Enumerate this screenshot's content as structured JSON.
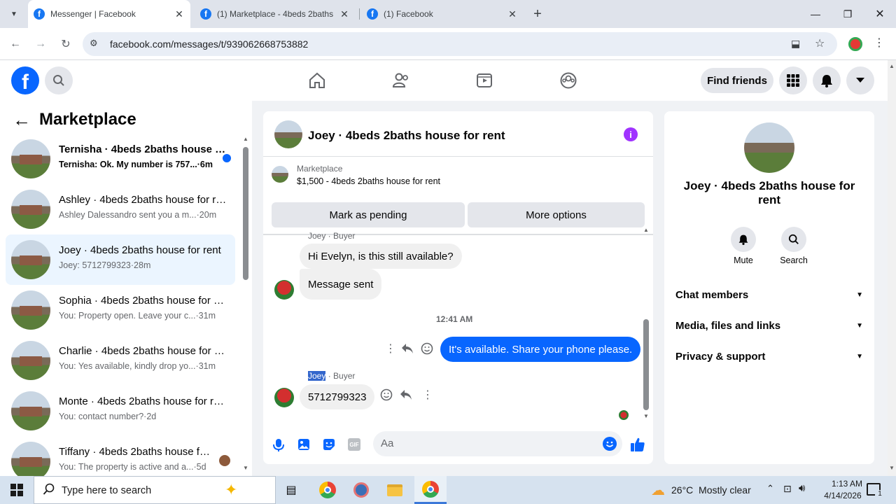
{
  "browser": {
    "tabs": [
      {
        "title": "Messenger | Facebook",
        "active": true
      },
      {
        "title": "(1) Marketplace - 4beds 2baths",
        "active": false
      },
      {
        "title": "(1) Facebook",
        "active": false
      }
    ],
    "url": "facebook.com/messages/t/939062668753882"
  },
  "fb_header": {
    "logo": "f",
    "find_friends": "Find friends"
  },
  "sidebar": {
    "title": "Marketplace",
    "conversations": [
      {
        "name": "Ternisha · 4beds 2baths house for rent",
        "preview": "Ternisha: Ok. My number is 757...",
        "time": "6m",
        "unread": true
      },
      {
        "name": "Ashley · 4beds 2baths house for rent",
        "preview": "Ashley Dalessandro sent you a m...",
        "time": "20m"
      },
      {
        "name": "Joey · 4beds 2baths house for rent",
        "preview": "Joey: 5712799323",
        "time": "28m",
        "selected": true
      },
      {
        "name": "Sophia · 4beds 2baths house for rent",
        "preview": "You: Property open. Leave your c...",
        "time": "31m"
      },
      {
        "name": "Charlie · 4beds 2baths house for rent",
        "preview": "You: Yes available, kindly drop yo...",
        "time": "31m"
      },
      {
        "name": "Monte · 4beds 2baths house for rent",
        "preview": "You: contact number?",
        "time": "2d"
      },
      {
        "name": "Tiffany · 4beds 2baths house for rent",
        "preview": "You: The property is active and a...",
        "time": "5d"
      }
    ]
  },
  "chat": {
    "title": "Joey · 4beds 2baths house for rent",
    "listing_source": "Marketplace",
    "listing": "$1,500 - 4beds 2baths house for rent",
    "mark_pending": "Mark as pending",
    "more_options": "More options",
    "sender_label_1": "Joey · Buyer",
    "msg1": "Hi Evelyn, is this still available?",
    "msg2": "Message sent",
    "timestamp": "12:41 AM",
    "msg3": "It's available. Share your phone please.",
    "sender_name_2": "Joey",
    "sender_role_2": " · Buyer",
    "msg4": "5712799323",
    "composer_placeholder": "Aa",
    "accent": "#0866ff"
  },
  "details": {
    "title": "Joey · 4beds 2baths house for rent",
    "mute": "Mute",
    "search": "Search",
    "sections": [
      "Chat members",
      "Media, files and links",
      "Privacy & support"
    ]
  },
  "taskbar": {
    "search_placeholder": "Type here to search",
    "weather": "26°C  Mostly clear",
    "time": "1:13 AM",
    "date": "4/14/2026",
    "notif_count": "1"
  }
}
